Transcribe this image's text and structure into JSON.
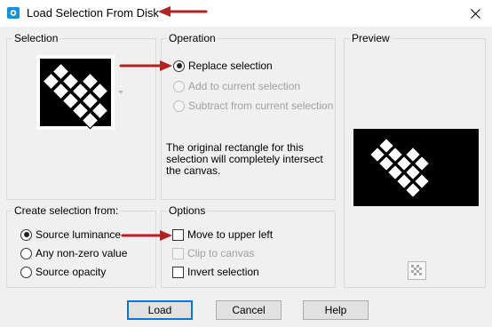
{
  "window": {
    "title": "Load Selection From Disk"
  },
  "selection": {
    "label": "Selection",
    "thumbnail_icon": "selection-thumbnail"
  },
  "operation": {
    "label": "Operation",
    "options": [
      {
        "label": "Replace selection",
        "checked": true,
        "enabled": true
      },
      {
        "label": "Add to current selection",
        "checked": false,
        "enabled": false
      },
      {
        "label": "Subtract from current selection",
        "checked": false,
        "enabled": false
      }
    ],
    "description": "The original rectangle for this selection will completely intersect the canvas."
  },
  "preview": {
    "label": "Preview"
  },
  "create_from": {
    "label": "Create selection from:",
    "options": [
      {
        "label": "Source luminance",
        "checked": true
      },
      {
        "label": "Any non-zero value",
        "checked": false
      },
      {
        "label": "Source opacity",
        "checked": false
      }
    ]
  },
  "options": {
    "label": "Options",
    "items": [
      {
        "label": "Move to upper left",
        "checked": false,
        "enabled": true
      },
      {
        "label": "Clip to canvas",
        "checked": false,
        "enabled": false
      },
      {
        "label": "Invert selection",
        "checked": false,
        "enabled": true
      }
    ]
  },
  "buttons": {
    "load": "Load",
    "cancel": "Cancel",
    "help": "Help"
  },
  "colors": {
    "annotation_arrow": "#b22222",
    "default_button_border": "#0078d7",
    "title_icon": "#1a8fd6"
  }
}
